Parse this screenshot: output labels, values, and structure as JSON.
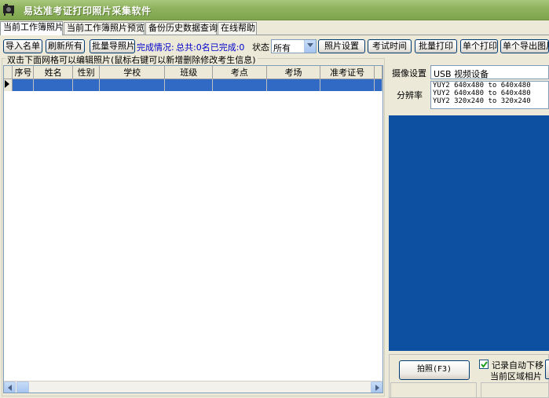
{
  "window": {
    "title": "易达准考证打印照片采集软件"
  },
  "tabs": [
    {
      "label": "当前工作簿照片"
    },
    {
      "label": "当前工作簿照片预览"
    },
    {
      "label": "备份历史数据查询"
    },
    {
      "label": "在线帮助"
    }
  ],
  "toolbar": {
    "import_list": "导入名单",
    "refresh_all": "刷新所有",
    "batch_import_photos": "批量导照片",
    "progress_label": "完成情况:",
    "progress_value": "总共:0名已完成:0",
    "state_label": "状态",
    "state_selected": "所有",
    "photo_settings": "照片设置",
    "exam_time": "考试时间",
    "batch_print": "批量打印",
    "single_print": "单个打印",
    "single_export": "单个导出图片"
  },
  "grid": {
    "hint": "双击下面网格可以编辑照片(鼠标右键可以新增删除修改考生信息)",
    "columns": [
      "序号",
      "姓名",
      "性别",
      "学校",
      "班级",
      "考点",
      "考场",
      "准考证号"
    ]
  },
  "camera": {
    "device_label": "摄像设置",
    "device_value": "USB 视频设备",
    "resolution_label": "分辨率",
    "resolutions": [
      "YUY2 640x480 to 640x480",
      "YUY2 640x480 to 640x480",
      "YUY2 320x240 to 320x240"
    ],
    "preview_color": "#0d4fa0"
  },
  "capture": {
    "shoot_button": "拍照(F3)",
    "auto_move_label": "记录自动下移",
    "auto_move_checked": true,
    "area_label": "当前区域相片"
  }
}
